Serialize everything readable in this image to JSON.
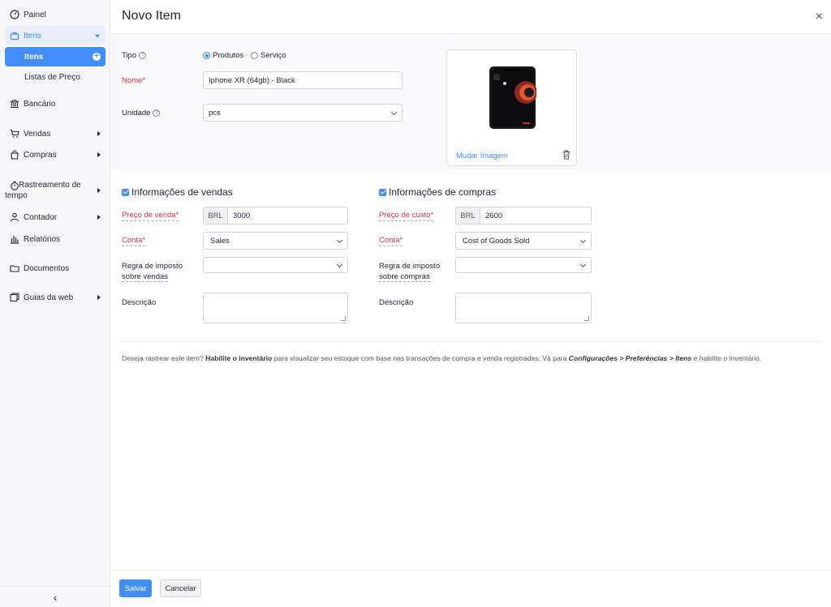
{
  "sidebar": {
    "items": [
      {
        "label": "Painel",
        "icon": "dashboard-icon"
      },
      {
        "label": "Itens",
        "icon": "basket-icon"
      },
      {
        "label": "Itens"
      },
      {
        "label": "Listas de Preço"
      },
      {
        "label": "Bancário",
        "icon": "bank-icon"
      },
      {
        "label": "Vendas",
        "icon": "cart-icon"
      },
      {
        "label": "Compras",
        "icon": "bag-icon"
      },
      {
        "label": "Rastreamento de tempo",
        "icon": "stopwatch-icon"
      },
      {
        "label": "Contador",
        "icon": "accountant-icon"
      },
      {
        "label": "Relatórios",
        "icon": "reports-icon"
      },
      {
        "label": "Documentos",
        "icon": "folder-icon"
      },
      {
        "label": "Guias da web",
        "icon": "web-tabs-icon"
      }
    ],
    "collapse": "‹"
  },
  "header": {
    "title": "Novo Item",
    "close": "×"
  },
  "form": {
    "tipo_label": "Tipo",
    "tipo_options": [
      "Produtos",
      "Serviço"
    ],
    "tipo_selected": "Produtos",
    "nome_label": "Nome*",
    "nome_value": "Iphone XR (64gb) -  Black",
    "unidade_label": "Unidade",
    "unidade_value": "pcs",
    "image": {
      "change_label": "Mudar Imagem"
    }
  },
  "sales": {
    "heading": "Informações de vendas",
    "price_label": "Preço de venda*",
    "currency": "BRL",
    "price_value": "3000",
    "account_label": "Conta*",
    "account_value": "Sales",
    "tax_label_1": "Regra de imposto",
    "tax_label_2": "sobre vendas",
    "tax_value": "",
    "desc_label": "Descrição"
  },
  "purchase": {
    "heading": "Informações de compras",
    "price_label": "Preço de custo*",
    "currency": "BRL",
    "price_value": "2600",
    "account_label": "Conta*",
    "account_value": "Cost of Goods Sold",
    "tax_label_1": "Regra de imposto",
    "tax_label_2": "sobre compras",
    "tax_value": "",
    "desc_label": "Descrição"
  },
  "note": {
    "part1": "Deseja rastrear este item? ",
    "bold": "Habilite o inventário",
    "part2": " para visualizar seu estoque com base nas transações de compra e venda registradas. Vá para ",
    "path": "Configurações > Preferências > Itens",
    "part3": " e habilite o inventário."
  },
  "footer": {
    "save": "Salvar",
    "cancel": "Cancelar"
  },
  "colors": {
    "accent": "#408dfb",
    "required": "#d6373a"
  }
}
